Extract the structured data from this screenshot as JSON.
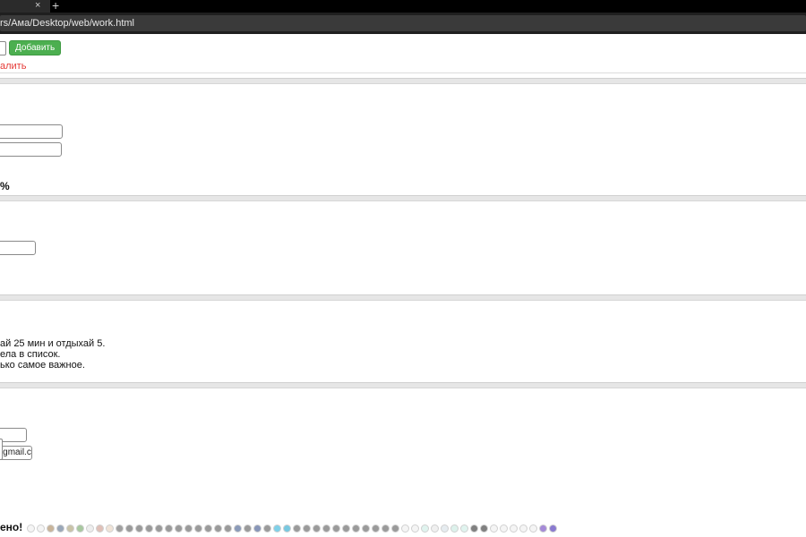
{
  "browser": {
    "tab_close": "×",
    "new_tab": "+",
    "url": "rs/Ама/Desktop/web/work.html"
  },
  "todo": {
    "add_label": "Добавить",
    "delete_label": "алить"
  },
  "stats": {
    "percent_text": "%"
  },
  "tips": [
    "ай 25 мин и отдыхай 5.",
    "ела в список.",
    "ько самое важное."
  ],
  "contact": {
    "email_value": "@gmail.c",
    "done_text": "ено!"
  },
  "dots": [
    {
      "color": "#f5f5f5"
    },
    {
      "color": "#f5f5f5"
    },
    {
      "color": "#c8b49a"
    },
    {
      "color": "#9aa7b8"
    },
    {
      "color": "#c9c3a8"
    },
    {
      "color": "#a8c8a0"
    },
    {
      "color": "#eeeeee"
    },
    {
      "color": "#e0c0b8"
    },
    {
      "color": "#f0e4d8"
    },
    {
      "color": "#a0a0a0"
    },
    {
      "color": "#9a9a9a"
    },
    {
      "color": "#9a9a9a"
    },
    {
      "color": "#9a9a9a"
    },
    {
      "color": "#9a9a9a"
    },
    {
      "color": "#9a9a9a"
    },
    {
      "color": "#9a9a9a"
    },
    {
      "color": "#9a9a9a"
    },
    {
      "color": "#9a9a9a"
    },
    {
      "color": "#9a9a9a"
    },
    {
      "color": "#9a9a9a"
    },
    {
      "color": "#9a9a9a"
    },
    {
      "color": "#8a9ab8"
    },
    {
      "color": "#9a9a9a"
    },
    {
      "color": "#8896b8"
    },
    {
      "color": "#9a9a9a"
    },
    {
      "color": "#7fd0e8"
    },
    {
      "color": "#78c8e0"
    },
    {
      "color": "#9a9a9a"
    },
    {
      "color": "#9a9a9a"
    },
    {
      "color": "#9a9a9a"
    },
    {
      "color": "#9a9a9a"
    },
    {
      "color": "#9a9a9a"
    },
    {
      "color": "#9a9a9a"
    },
    {
      "color": "#9a9a9a"
    },
    {
      "color": "#9a9a9a"
    },
    {
      "color": "#9a9a9a"
    },
    {
      "color": "#9a9a9a"
    },
    {
      "color": "#9a9a9a"
    },
    {
      "color": "#f5f5f5"
    },
    {
      "color": "#f5f5f5"
    },
    {
      "color": "#e0f4ef"
    },
    {
      "color": "#f0f0f0"
    },
    {
      "color": "#e6ecf0"
    },
    {
      "color": "#ddf2ec"
    },
    {
      "color": "#e0f4ef"
    },
    {
      "color": "#808080"
    },
    {
      "color": "#808080"
    },
    {
      "color": "#f5f5f5"
    },
    {
      "color": "#f5f5f5"
    },
    {
      "color": "#f5f5f5"
    },
    {
      "color": "#f5f5f5"
    },
    {
      "color": "#f5f5f5"
    },
    {
      "color": "#a58ad8"
    },
    {
      "color": "#8a7ad0"
    }
  ]
}
